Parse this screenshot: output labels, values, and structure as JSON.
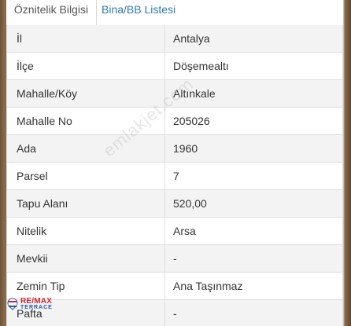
{
  "tabs": [
    {
      "label": "Öznitelik Bilgisi"
    },
    {
      "label": "Bina/BB Listesi"
    }
  ],
  "rows": [
    {
      "label": "İl",
      "value": "Antalya"
    },
    {
      "label": "İlçe",
      "value": "Döşemealtı"
    },
    {
      "label": "Mahalle/Köy",
      "value": "Altınkale"
    },
    {
      "label": "Mahalle No",
      "value": "205026"
    },
    {
      "label": "Ada",
      "value": "1960"
    },
    {
      "label": "Parsel",
      "value": "7"
    },
    {
      "label": "Tapu Alanı",
      "value": "520,00"
    },
    {
      "label": "Nitelik",
      "value": "Arsa"
    },
    {
      "label": "Mevkii",
      "value": "-"
    },
    {
      "label": "Zemin Tip",
      "value": "Ana Taşınmaz"
    },
    {
      "label": "Pafta",
      "value": "-"
    }
  ],
  "watermark": "emlakjet.com",
  "logo": {
    "top": "RE/MAX",
    "bottom": "TERRACE",
    "icon": "balloon-icon"
  }
}
